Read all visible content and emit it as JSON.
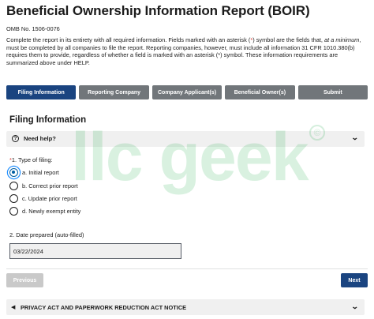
{
  "header": {
    "title": "Beneficial Ownership Information Report (BOIR)",
    "omb": "OMB No. 1506-0076",
    "intro_part1": "Complete the report in its entirety with all required information. Fields marked with an asterisk (",
    "intro_asterisk": "*",
    "intro_part2": ") symbol are the fields that, ",
    "intro_italic": "at a minimum",
    "intro_part3": ", must be completed by all companies to file the report. Reporting companies, however, must include all information 31 CFR 1010.380(b) requires them to provide, regardless of whether a field is marked with an asterisk (*) symbol. These information requirements are summarized above under HELP."
  },
  "tabs": [
    {
      "label": "Filing Information",
      "active": true
    },
    {
      "label": "Reporting Company",
      "active": false
    },
    {
      "label": "Company Applicant(s)",
      "active": false
    },
    {
      "label": "Beneficial Owner(s)",
      "active": false
    },
    {
      "label": "Submit",
      "active": false
    }
  ],
  "section": {
    "title": "Filing Information",
    "help_label": "Need help?",
    "help_icon": "question-circle-icon"
  },
  "filing_type": {
    "asterisk": "*",
    "label": "1. Type of filing:",
    "options": [
      {
        "label": "a. Initial report",
        "checked": true
      },
      {
        "label": "b. Correct prior report",
        "checked": false
      },
      {
        "label": "c. Update prior report",
        "checked": false
      },
      {
        "label": "d. Newly exempt entity",
        "checked": false
      }
    ]
  },
  "date_prepared": {
    "label": "2. Date prepared (auto-filled)",
    "value": "03/22/2024"
  },
  "nav": {
    "previous_label": "Previous",
    "next_label": "Next"
  },
  "privacy": {
    "label": "PRIVACY ACT AND PAPERWORK REDUCTION ACT NOTICE",
    "icon": "megaphone-icon"
  },
  "watermark": {
    "text": "llc geek",
    "mark": "©"
  },
  "colors": {
    "primary": "#1a4480",
    "tab_inactive": "#71767a",
    "required": "#d83933",
    "radio_checked": "#005ea2",
    "watermark": "#2eaf54"
  }
}
